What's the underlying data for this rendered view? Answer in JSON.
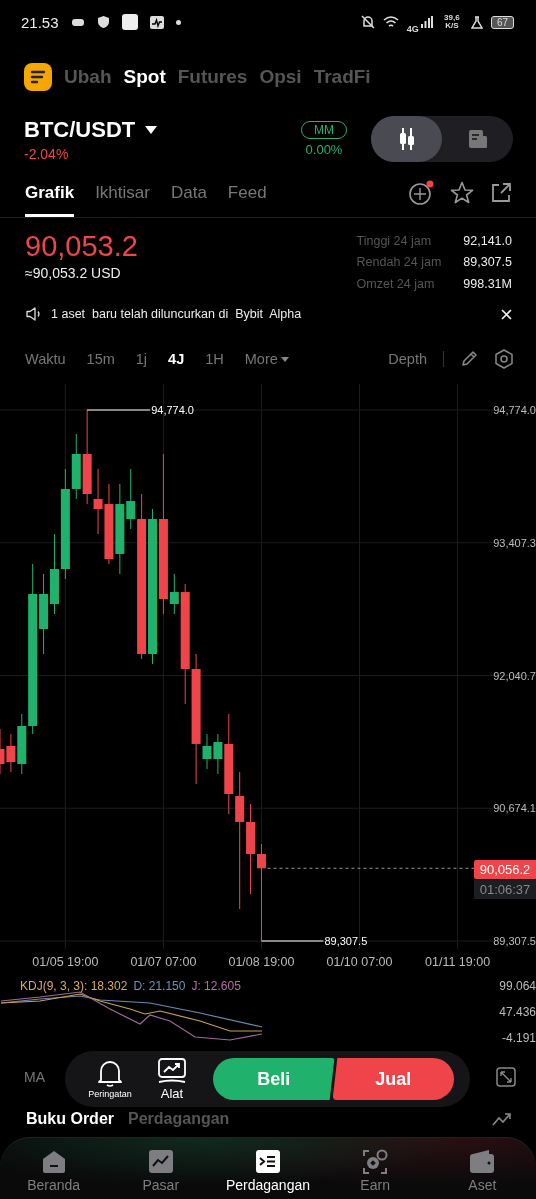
{
  "status_bar": {
    "time": "21.53",
    "network": "4G",
    "speed": "39,6 K/S",
    "battery": "67"
  },
  "product_tabs": [
    {
      "label": "Ubah",
      "selected": false
    },
    {
      "label": "Spot",
      "selected": true
    },
    {
      "label": "Futures",
      "selected": false
    },
    {
      "label": "Opsi",
      "selected": false
    },
    {
      "label": "TradFi",
      "selected": false
    }
  ],
  "pair": {
    "symbol": "BTC/USDT",
    "change": "-2.04%",
    "mm_badge": "MM",
    "mm_rate": "0.00%"
  },
  "view_toggle": [
    {
      "kind": "candles",
      "selected": true
    },
    {
      "kind": "book",
      "selected": false
    }
  ],
  "detail_tabs": [
    {
      "label": "Grafik",
      "selected": true
    },
    {
      "label": "Ikhtisar",
      "selected": false
    },
    {
      "label": "Data",
      "selected": false
    },
    {
      "label": "Feed",
      "selected": false
    }
  ],
  "fee_notification": true,
  "price": {
    "last": "90,053.2",
    "usd": "≈90,053.2 USD",
    "stats": [
      {
        "label": "Tinggi 24 jam",
        "value": "92,141.0"
      },
      {
        "label": "Rendah 24 jam",
        "value": "89,307.5"
      },
      {
        "label": "Omzet 24 jam",
        "value": "998.31M"
      }
    ]
  },
  "announcement": "1 aset  baru telah diluncurkan di  Bybit  Alpha",
  "intervals": [
    {
      "label": "Waktu",
      "selected": false
    },
    {
      "label": "15m",
      "selected": false
    },
    {
      "label": "1j",
      "selected": false
    },
    {
      "label": "4J",
      "selected": true
    },
    {
      "label": "1H",
      "selected": false
    },
    {
      "label": "More",
      "selected": false
    }
  ],
  "depth_label": "Depth",
  "chart": {
    "high_marker": "94,774.0",
    "low_marker": "89,307.5",
    "last_price": "90,056.2",
    "countdown": "01:06:37",
    "chart_data": {
      "type": "candlestick",
      "categories": [
        null,
        null,
        null,
        null,
        null,
        null,
        "01/05 19:00",
        null,
        null,
        null,
        null,
        null,
        null,
        null,
        null,
        "01/07 07:00",
        null,
        null,
        null,
        null,
        null,
        null,
        null,
        null,
        "01/08 19:00",
        null,
        null,
        null,
        null,
        null,
        null,
        null,
        null,
        "01/10 07:00",
        null,
        null,
        null,
        null,
        null,
        null,
        null,
        null,
        "01/11 19:00"
      ],
      "ohlc": [
        [
          91284,
          91490,
          91027,
          91130
        ],
        [
          91315,
          91438,
          91047,
          91150
        ],
        [
          91130,
          91644,
          91027,
          91521
        ],
        [
          91521,
          93189,
          91438,
          92880
        ],
        [
          92519,
          93086,
          92262,
          92880
        ],
        [
          92777,
          93497,
          92674,
          93137
        ],
        [
          93137,
          94167,
          93034,
          93961
        ],
        [
          93961,
          94527,
          93858,
          94321
        ],
        [
          94321,
          94774,
          93806,
          93909
        ],
        [
          93858,
          94167,
          93497,
          93755
        ],
        [
          93806,
          94012,
          93189,
          93240
        ],
        [
          93292,
          94012,
          93086,
          93806
        ],
        [
          93652,
          94167,
          93549,
          93837
        ],
        [
          93652,
          93909,
          92211,
          92262
        ],
        [
          92262,
          93755,
          92159,
          93652
        ],
        [
          93652,
          94321,
          92674,
          92828
        ],
        [
          92777,
          93086,
          92674,
          92900
        ],
        [
          92900,
          92983,
          91747,
          92108
        ],
        [
          92108,
          92262,
          90924,
          91336
        ],
        [
          91181,
          91438,
          91078,
          91315
        ],
        [
          91181,
          91438,
          91027,
          91356
        ],
        [
          91336,
          91644,
          90615,
          90821
        ],
        [
          90800,
          91047,
          89637,
          90533
        ],
        [
          90533,
          90718,
          89791,
          90203
        ],
        [
          90203,
          90306,
          89307.5,
          90056.2
        ],
        null,
        null,
        null,
        null,
        null,
        null,
        null,
        null,
        null,
        null,
        null,
        null,
        null,
        null,
        null,
        null,
        null,
        null
      ],
      "ylim": [
        89307.5,
        94774
      ],
      "grid": true,
      "yticks": [
        {
          "value": 94774,
          "label": "94,774.0"
        },
        {
          "value": 93407.3,
          "label": "93,407.3"
        },
        {
          "value": 92040.7,
          "label": "92,040.7"
        },
        {
          "value": 90674.1,
          "label": "90,674.1"
        },
        {
          "value": 89307.5,
          "label": "89,307.5"
        }
      ]
    }
  },
  "kdj": {
    "k": "KDJ(9, 3, 3): 18.302",
    "d": "D: 21.150",
    "j": "J: 12.605",
    "axis": [
      "99.064",
      "47.436",
      "-4.191"
    ]
  },
  "indicator_label": "MA",
  "lower_tabs": [
    "Buku Order",
    "Perdagangan"
  ],
  "action_bar": {
    "tools": [
      {
        "kind": "bell",
        "label": "Peringatan"
      },
      {
        "kind": "chart",
        "label": "Alat"
      }
    ],
    "buy": "Beli",
    "sell": "Jual"
  },
  "bottom_nav": [
    {
      "kind": "home",
      "label": "Beranda",
      "selected": false
    },
    {
      "kind": "market",
      "label": "Pasar",
      "selected": false
    },
    {
      "kind": "trade",
      "label": "Perdagangan",
      "selected": true
    },
    {
      "kind": "earn",
      "label": "Earn",
      "selected": false
    },
    {
      "kind": "wallet",
      "label": "Aset",
      "selected": false
    }
  ]
}
